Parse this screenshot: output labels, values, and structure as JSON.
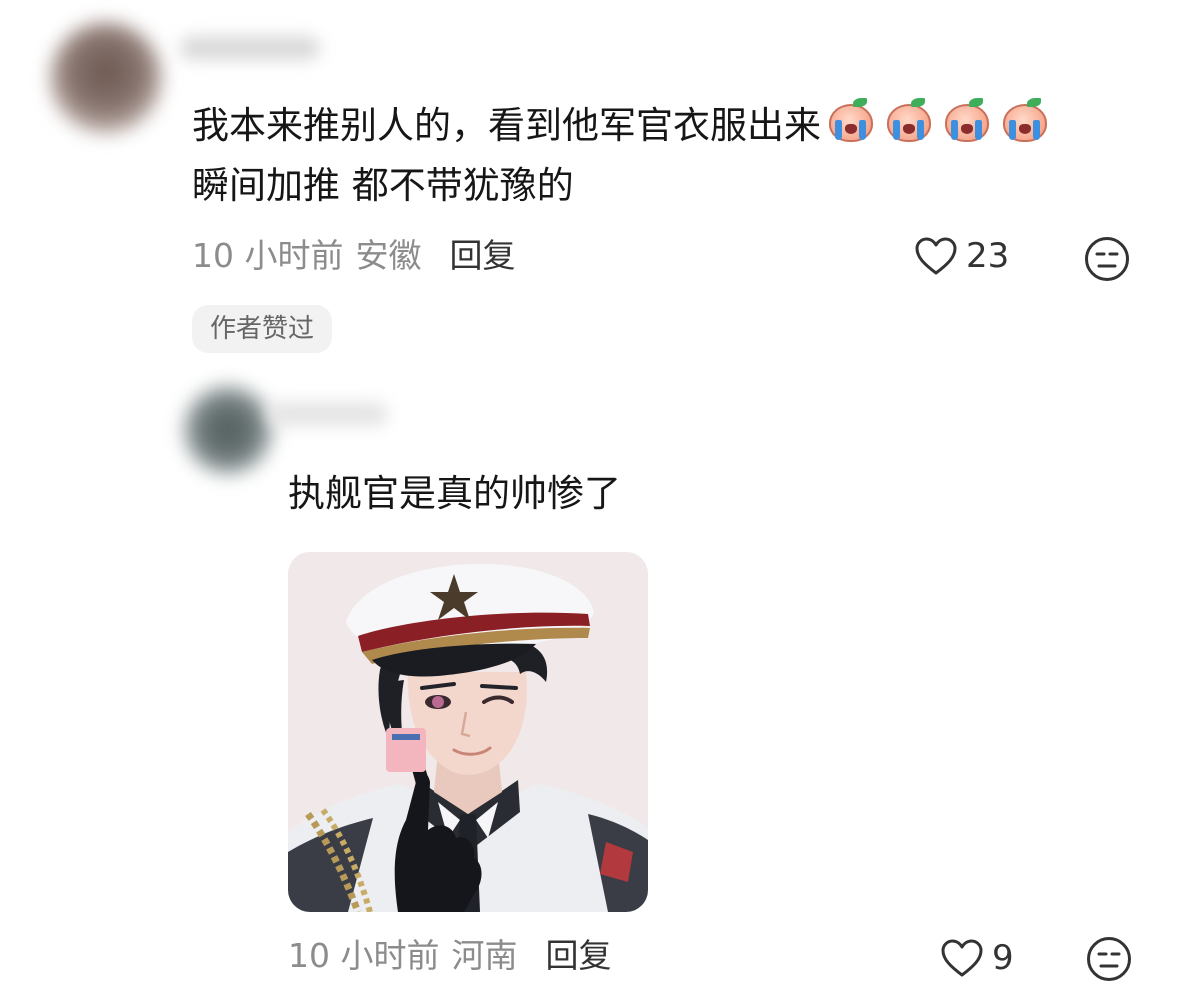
{
  "comments": [
    {
      "text_line1": "我本来推别人的，看到他军官衣服出来",
      "text_line2": "瞬间加推 都不带犹豫的",
      "emoji_count": 4,
      "emoji_icon": "crying-peach-emoji",
      "time": "10 小时前",
      "location": "安徽",
      "reply_label": "回复",
      "likes": "23",
      "badge": "作者赞过"
    },
    {
      "text_line1": "执舰官是真的帅惨了",
      "time": "10 小时前",
      "location": "河南",
      "reply_label": "回复",
      "likes": "9"
    }
  ],
  "colors": {
    "text": "#161616",
    "meta": "#8c8c8c",
    "badge_bg": "#f2f2f2"
  }
}
